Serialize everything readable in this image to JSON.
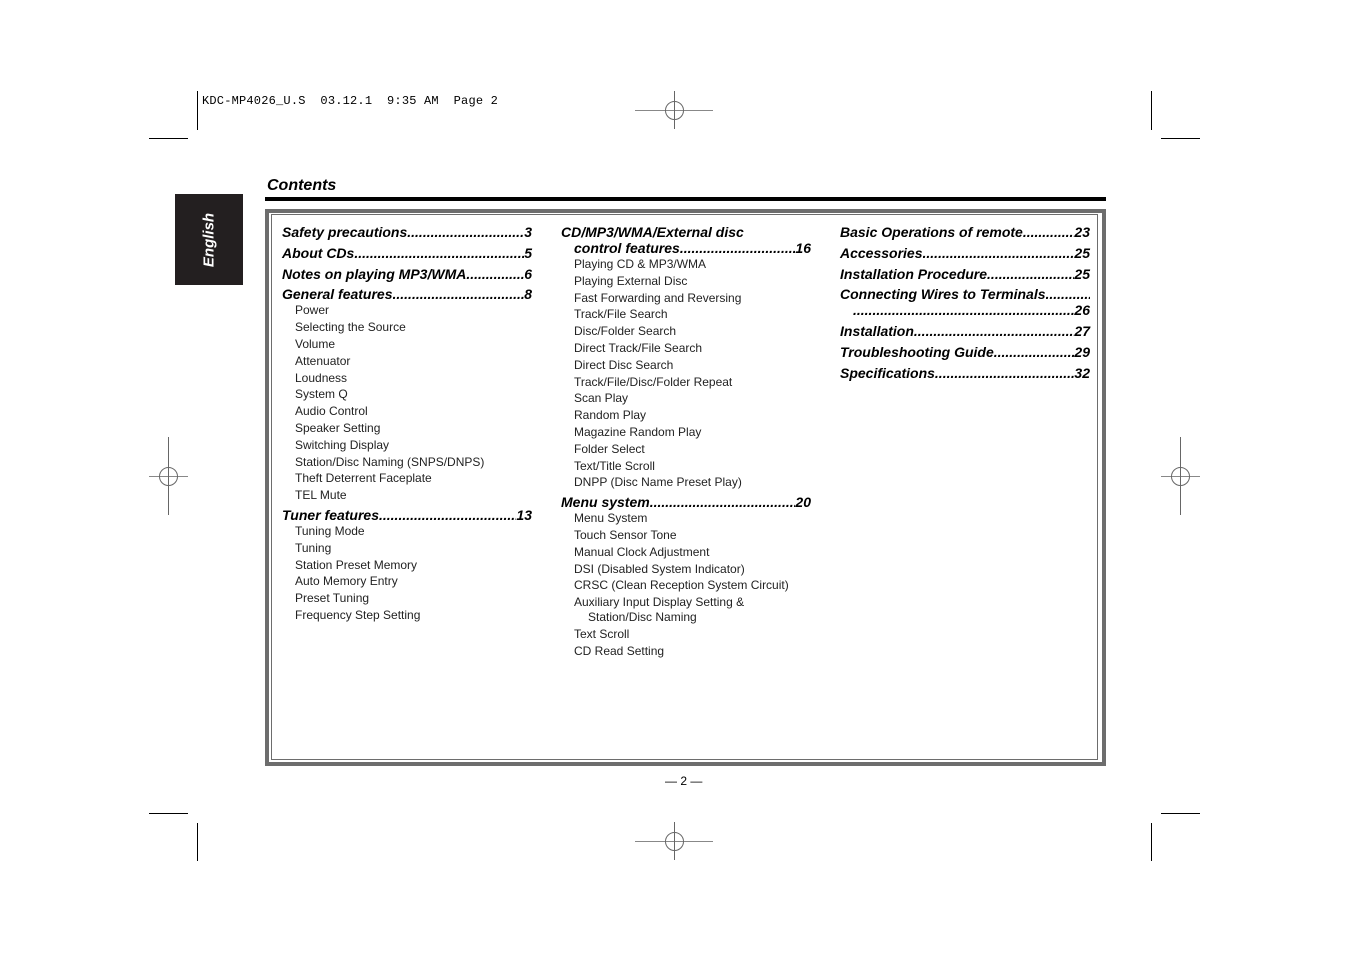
{
  "slug": "KDC-MP4026_U.S  03.12.1  9:35 AM  Page 2",
  "language_tab": "English",
  "title": "Contents",
  "page_number": "— 2 —",
  "columns": [
    {
      "sections": [
        {
          "label": "Safety precautions",
          "page": "3",
          "items": []
        },
        {
          "label": "About CDs",
          "page": "5",
          "items": []
        },
        {
          "label": "Notes on playing MP3/WMA",
          "page": "6",
          "items": []
        },
        {
          "label": "General features ",
          "page": "8",
          "items": [
            "Power",
            "Selecting the Source",
            "Volume",
            "Attenuator",
            "Loudness",
            "System Q",
            "Audio Control",
            "Speaker Setting",
            "Switching Display",
            "Station/Disc Naming (SNPS/DNPS)",
            "Theft Deterrent Faceplate",
            "TEL Mute"
          ]
        },
        {
          "label": "Tuner features",
          "page": "13",
          "items": [
            "Tuning Mode",
            "Tuning",
            "Station Preset Memory",
            "Auto Memory Entry",
            "Preset Tuning",
            "Frequency Step Setting"
          ]
        }
      ]
    },
    {
      "sections": [
        {
          "label": "CD/MP3/WMA/External disc",
          "label2": "control features ",
          "page": "16",
          "items": [
            "Playing CD & MP3/WMA",
            "Playing External Disc",
            "Fast Forwarding and Reversing",
            "Track/File Search",
            "Disc/Folder Search",
            "Direct Track/File Search",
            "Direct Disc Search",
            "Track/File/Disc/Folder Repeat",
            "Scan Play",
            "Random Play",
            "Magazine Random Play",
            "Folder Select",
            "Text/Title Scroll",
            "DNPP (Disc Name Preset Play)"
          ]
        },
        {
          "label": "Menu system",
          "page": "20",
          "items": [
            "Menu System",
            "Touch Sensor Tone",
            "Manual Clock Adjustment",
            "DSI (Disabled System Indicator)",
            "CRSC (Clean Reception System Circuit)",
            "Auxiliary Input Display Setting &",
            "Station/Disc Naming",
            "Text Scroll",
            "CD Read Setting"
          ]
        }
      ]
    },
    {
      "sections": [
        {
          "label": "Basic Operations of remote",
          "page": "23"
        },
        {
          "label": "Accessories",
          "page": "25"
        },
        {
          "label": "Installation Procedure ",
          "page": "25"
        },
        {
          "label": "Connecting Wires to Terminals ",
          "page": "26"
        },
        {
          "label": "Installation ",
          "page": "27"
        },
        {
          "label": "Troubleshooting Guide ",
          "page": "29"
        },
        {
          "label": "Specifications ",
          "page": "32"
        }
      ]
    }
  ]
}
